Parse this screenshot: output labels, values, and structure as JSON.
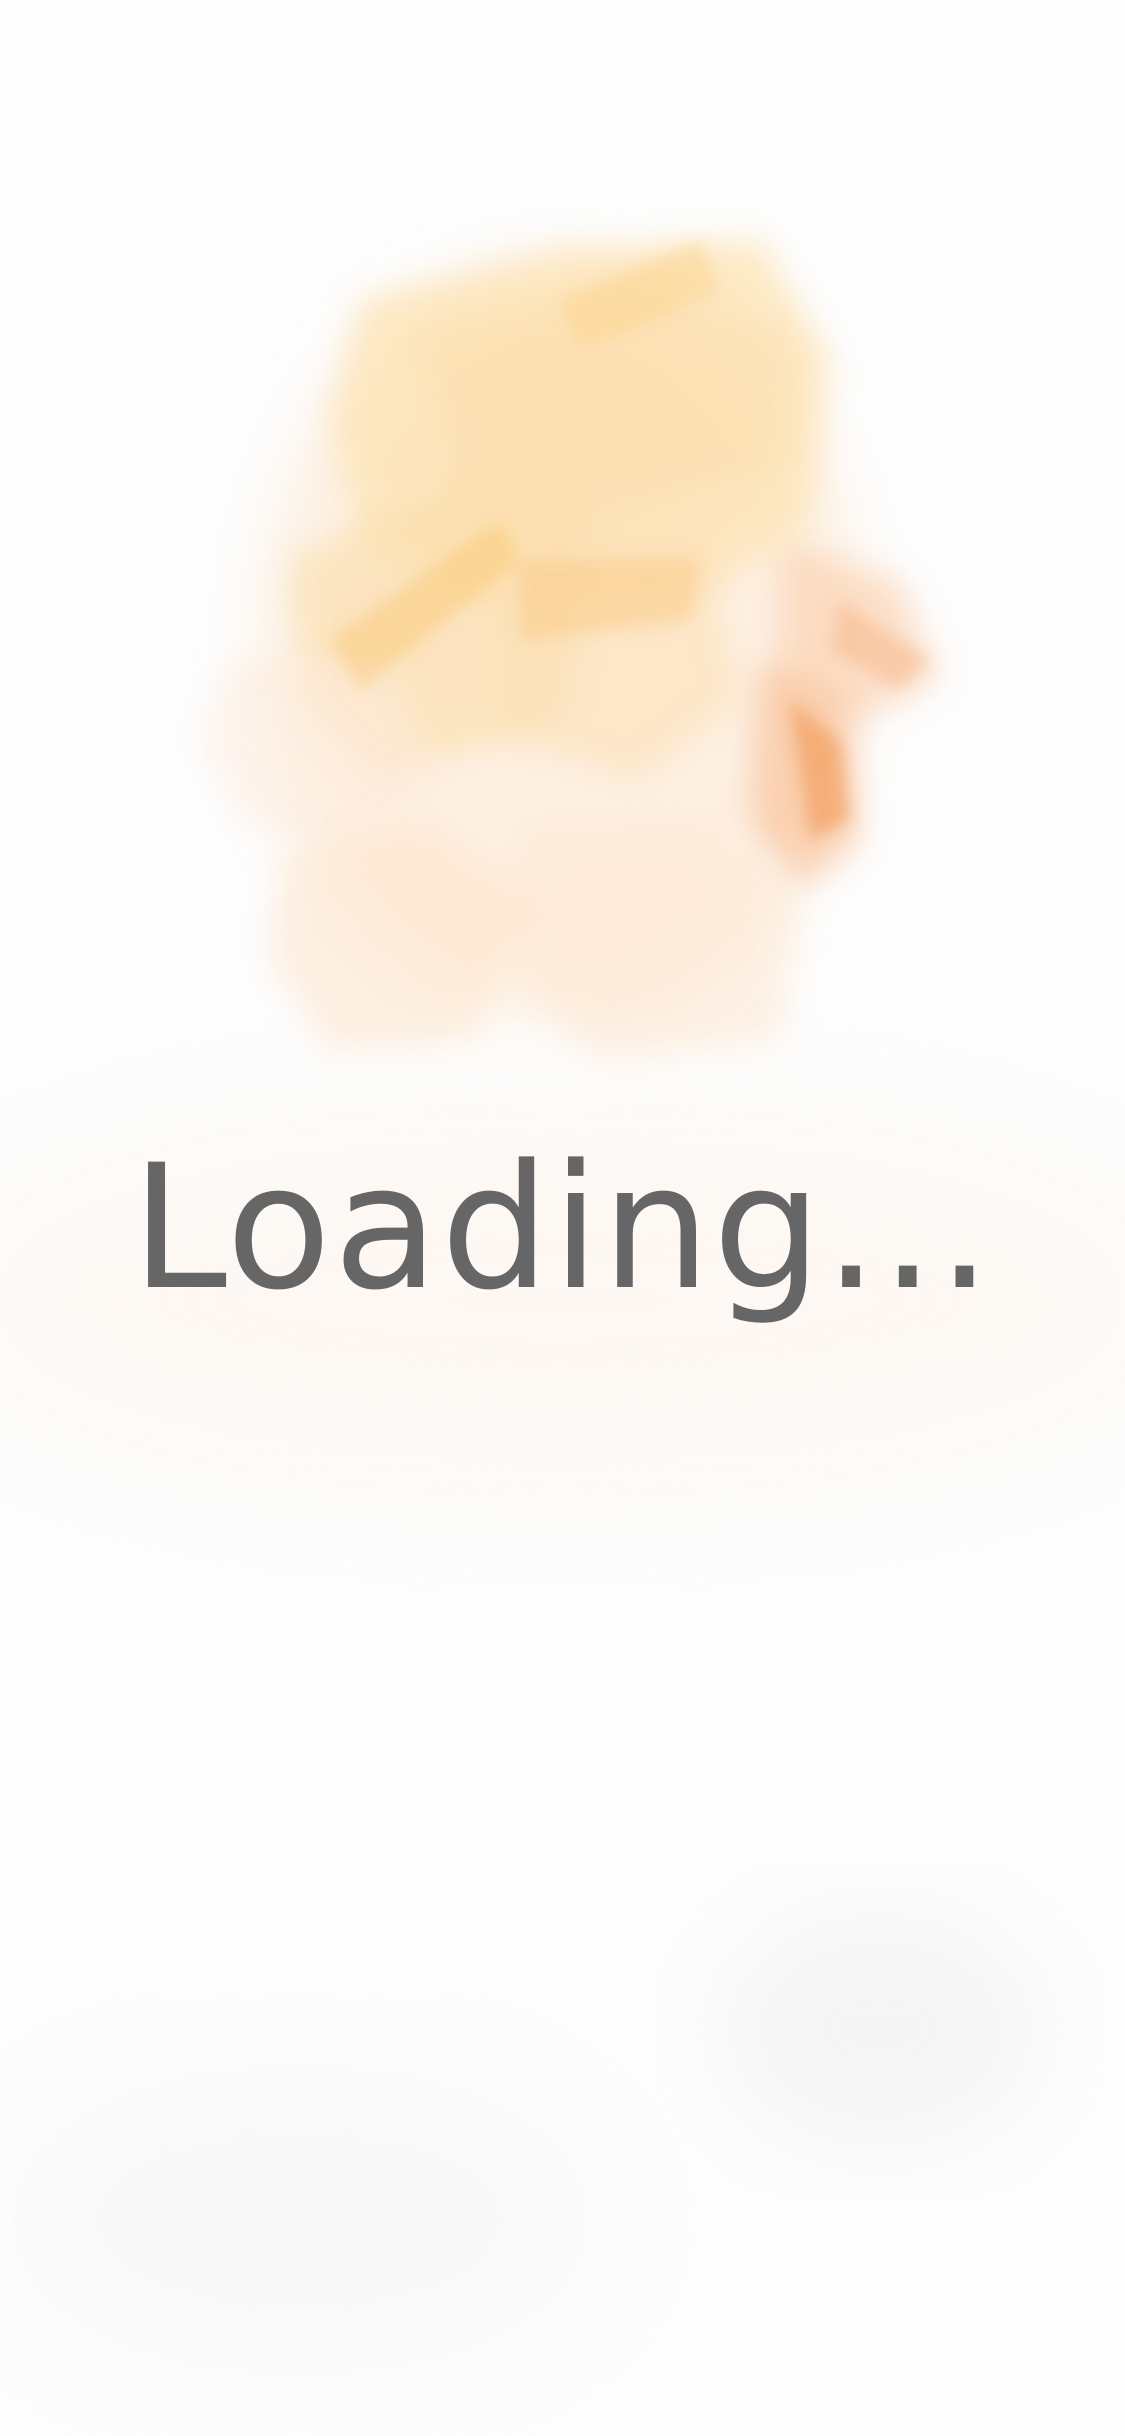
{
  "loading": {
    "label": "Loading..."
  },
  "colors": {
    "background": "#fdfdfd",
    "text": "#666666",
    "paint_yellow": "#f9d77e",
    "paint_peach": "#fbd8b5",
    "paint_orange": "#f08a3c"
  },
  "icons": {
    "splash_art": "watercolor-splash"
  }
}
